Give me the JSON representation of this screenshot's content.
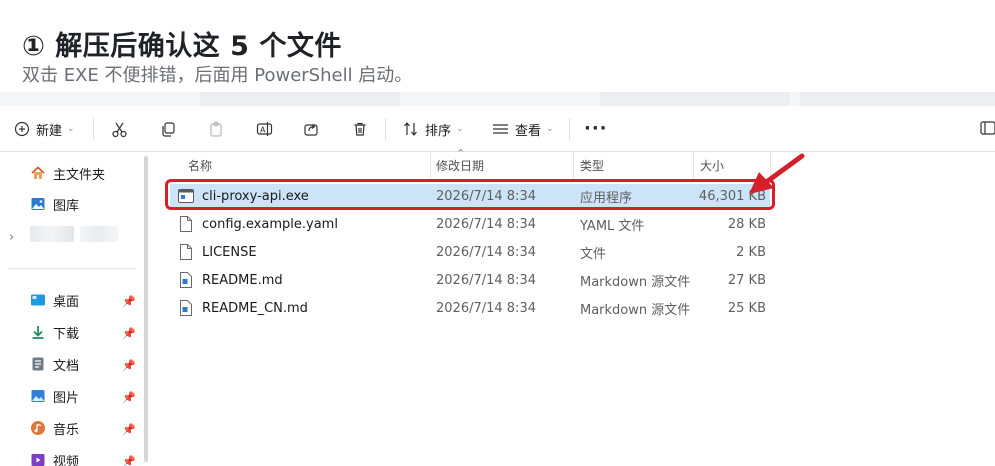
{
  "heading": {
    "title": "① 解压后确认这 5 个文件",
    "subtitle": "双击 EXE 不便排错，后面用 PowerShell 启动。"
  },
  "toolbar": {
    "new_label": "新建",
    "sort_label": "排序",
    "view_label": "查看",
    "more_label": "···"
  },
  "sidebar": {
    "top_items": [
      {
        "label": "主文件夹",
        "icon": "home-icon"
      },
      {
        "label": "图库",
        "icon": "gallery-icon"
      }
    ],
    "pinned_items": [
      {
        "label": "桌面",
        "icon": "desktop-icon"
      },
      {
        "label": "下载",
        "icon": "download-icon"
      },
      {
        "label": "文档",
        "icon": "document-icon"
      },
      {
        "label": "图片",
        "icon": "pictures-icon"
      },
      {
        "label": "音乐",
        "icon": "music-icon"
      },
      {
        "label": "视频",
        "icon": "video-icon"
      }
    ]
  },
  "columns": {
    "name": "名称",
    "modified": "修改日期",
    "type": "类型",
    "size": "大小"
  },
  "files": [
    {
      "name": "cli-proxy-api.exe",
      "modified": "2026/7/14 8:34",
      "type": "应用程序",
      "size": "46,301 KB",
      "icon": "exe-icon",
      "selected": true
    },
    {
      "name": "config.example.yaml",
      "modified": "2026/7/14 8:34",
      "type": "YAML 文件",
      "size": "28 KB",
      "icon": "file-icon",
      "selected": false
    },
    {
      "name": "LICENSE",
      "modified": "2026/7/14 8:34",
      "type": "文件",
      "size": "2 KB",
      "icon": "file-icon",
      "selected": false
    },
    {
      "name": "README.md",
      "modified": "2026/7/14 8:34",
      "type": "Markdown 源文件",
      "size": "27 KB",
      "icon": "markdown-icon",
      "selected": false
    },
    {
      "name": "README_CN.md",
      "modified": "2026/7/14 8:34",
      "type": "Markdown 源文件",
      "size": "25 KB",
      "icon": "markdown-icon",
      "selected": false
    }
  ],
  "colors": {
    "selection": "#cce4f7",
    "highlight": "#d4202a"
  }
}
